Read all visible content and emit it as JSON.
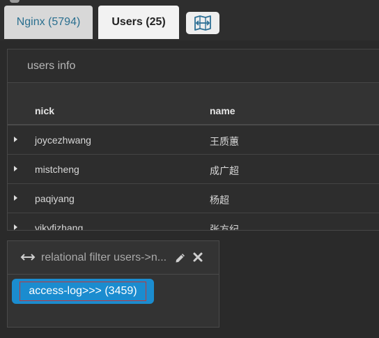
{
  "tabs": [
    {
      "label": "Nginx (5794)"
    },
    {
      "label": "Users (25)"
    }
  ],
  "map_button": {
    "icon": "map-icon"
  },
  "users_panel": {
    "title": "users info",
    "columns": [
      "nick",
      "name"
    ],
    "rows": [
      {
        "nick": "joycezhwang",
        "name": "王质蕙"
      },
      {
        "nick": "mistcheng",
        "name": "成广超"
      },
      {
        "nick": "paqiyang",
        "name": "杨超"
      },
      {
        "nick": "vikyfizhang",
        "name": "张方纪"
      }
    ]
  },
  "filter_panel": {
    "title": "relational filter users->n...",
    "icons": [
      "arrows-horizontal-icon",
      "pencil-icon",
      "close-icon"
    ],
    "item_label": "access-log>>> (3459)"
  },
  "colors": {
    "background": "#2a2a2a",
    "active_tab": "#f2f2f2",
    "inactive_tab_text": "#2a6f8f",
    "pill": "#1b8ccf",
    "pill_border": "#c03838"
  }
}
